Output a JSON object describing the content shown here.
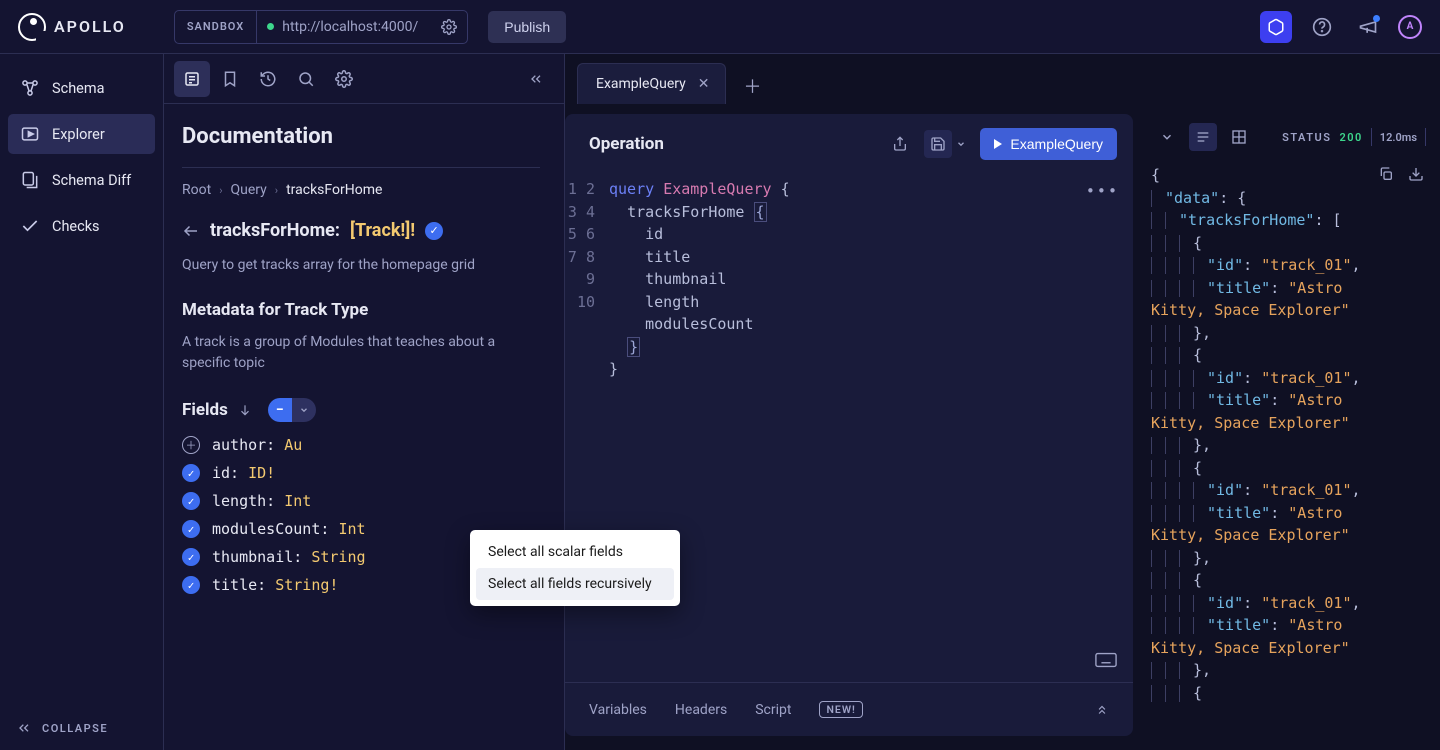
{
  "brand": "APOLLO",
  "header": {
    "sandbox_tag": "SANDBOX",
    "url": "http://localhost:4000/",
    "publish": "Publish"
  },
  "nav": {
    "items": [
      {
        "label": "Schema"
      },
      {
        "label": "Explorer"
      },
      {
        "label": "Schema Diff"
      },
      {
        "label": "Checks"
      }
    ],
    "collapse": "COLLAPSE"
  },
  "docs": {
    "heading": "Documentation",
    "breadcrumb": {
      "root": "Root",
      "mid": "Query",
      "cur": "tracksForHome"
    },
    "field": {
      "name": "tracksForHome:",
      "type": "[Track!]!"
    },
    "desc": "Query to get tracks array for the homepage grid",
    "metadata_title": "Metadata for Track Type",
    "metadata_desc": "A track is a group of Modules that teaches about a specific topic",
    "fields_label": "Fields",
    "fields": [
      {
        "name": "author:",
        "type": "Au",
        "checked": false
      },
      {
        "name": "id:",
        "type": "ID!",
        "checked": true
      },
      {
        "name": "length:",
        "type": "Int",
        "checked": true
      },
      {
        "name": "modulesCount:",
        "type": "Int",
        "checked": true
      },
      {
        "name": "thumbnail:",
        "type": "String",
        "checked": true
      },
      {
        "name": "title:",
        "type": "String!",
        "checked": true
      }
    ],
    "dropdown": {
      "opt1": "Select all scalar fields",
      "opt2": "Select all fields recursively"
    }
  },
  "tabs": {
    "active": "ExampleQuery"
  },
  "operation": {
    "title": "Operation",
    "run_label": "ExampleQuery",
    "code": {
      "l1a": "query",
      "l1b": "ExampleQuery",
      "l1c": "{",
      "l2": "tracksForHome",
      "l3": "id",
      "l4": "title",
      "l5": "thumbnail",
      "l6": "length",
      "l7": "modulesCount"
    }
  },
  "bottom": {
    "variables": "Variables",
    "headers": "Headers",
    "script": "Script",
    "new": "NEW!"
  },
  "response": {
    "status_label": "STATUS",
    "status_code": "200",
    "time": "12.0ms",
    "track_id": "\"track_01\"",
    "track_title_a": "\"Astro",
    "track_title_b": "Kitty, Space Explorer\"",
    "k_data": "\"data\"",
    "k_tracks": "\"tracksForHome\"",
    "k_id": "\"id\"",
    "k_title": "\"title\""
  }
}
